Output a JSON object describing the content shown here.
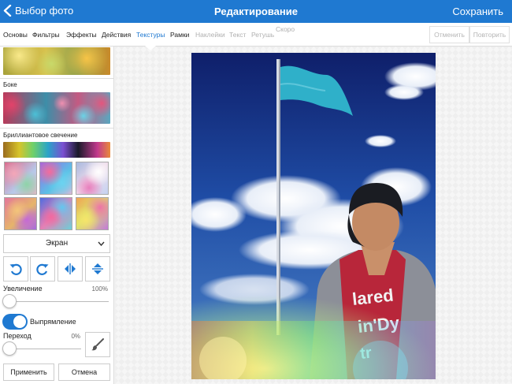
{
  "header": {
    "back_label": "Выбор фото",
    "title": "Редактирование",
    "save_label": "Сохранить"
  },
  "tabs": [
    {
      "label": "Основы",
      "state": "normal"
    },
    {
      "label": "Фильтры",
      "state": "normal"
    },
    {
      "label": "Эффекты",
      "state": "normal"
    },
    {
      "label": "Действия",
      "state": "normal"
    },
    {
      "label": "Текстуры",
      "state": "active"
    },
    {
      "label": "Рамки",
      "state": "normal"
    },
    {
      "label": "Наклейки",
      "state": "disabled"
    },
    {
      "label": "Текст",
      "state": "disabled"
    },
    {
      "label": "Ретушь",
      "state": "disabled"
    },
    {
      "label": "Скоро",
      "state": "disabled"
    }
  ],
  "history": {
    "undo_label": "Отменить",
    "redo_label": "Повторить"
  },
  "textures": {
    "sections": [
      "Боке",
      "Бриллиантовое свечение"
    ],
    "blend_mode": "Экран"
  },
  "controls": {
    "zoom_label": "Увеличение",
    "zoom_value": "100%",
    "zoom_fraction": 0.0,
    "straighten_label": "Выпрямление",
    "straighten_on": true,
    "transition_label": "Переход",
    "transition_value": "0%",
    "transition_fraction": 0.0,
    "apply_label": "Применить",
    "cancel_label": "Отмена"
  },
  "colors": {
    "accent": "#1f79d1",
    "disabled": "#b0b0b0"
  },
  "icons": [
    "chevron-left-icon",
    "chevron-down-icon",
    "rotate-left-icon",
    "rotate-right-icon",
    "flip-horizontal-icon",
    "flip-vertical-icon",
    "brush-icon"
  ]
}
